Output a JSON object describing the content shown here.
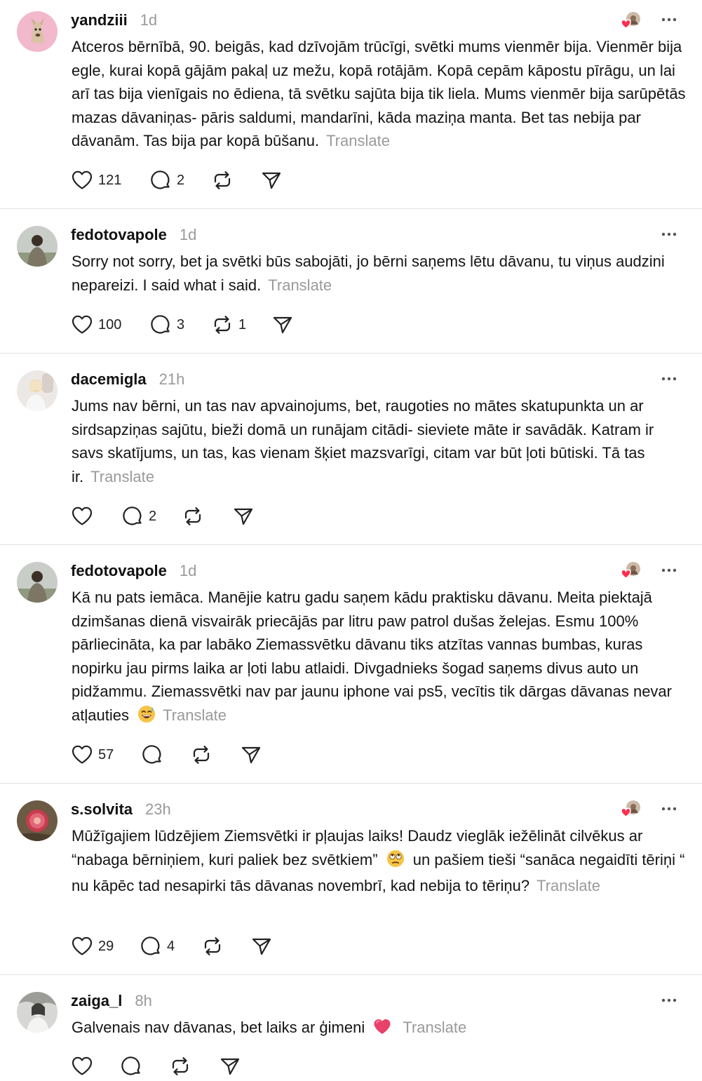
{
  "translate_label": "Translate",
  "posts": [
    {
      "username": "yandziii",
      "time": "1d",
      "text": "Atceros bērnībā, 90. beigās, kad dzīvojām trūcīgi, svētki mums vienmēr bija. Vienmēr bija egle, kurai kopā gājām pakaļ uz mežu, kopā rotājām. Kopā cepām kāpostu pīrāgu, un lai arī tas bija vienīgais no ēdiena, tā svētku sajūta bija tik liela. Mums vienmēr bija sarūpētās mazas dāvaniņas- pāris saldumi, mandarīni, kāda maziņa manta. Bet tas nebija par dāvanām. Tas bija par kopā būšanu.",
      "likes": "121",
      "replies": "2",
      "reposts": "",
      "liked_by_author": true
    },
    {
      "username": "fedotovapole",
      "time": "1d",
      "text": "Sorry not sorry, bet ja svētki būs sabojāti, jo bērni saņems lētu dāvanu, tu viņus audzini nepareizi. I said what i said.",
      "likes": "100",
      "replies": "3",
      "reposts": "1",
      "liked_by_author": false
    },
    {
      "username": "dacemigla",
      "time": "21h",
      "text": "Jums nav bērni, un tas nav apvainojums, bet, raugoties no mātes skatupunkta un ar sirdsapziņas sajūtu, bieži domā un runājam citādi- sieviete māte ir savādāk. Katram ir savs skatījums, un tas, kas vienam šķiet mazsvarīgi, citam var būt ļoti būtiski. Tā tas ir.",
      "likes": "",
      "replies": "2",
      "reposts": "",
      "liked_by_author": false
    },
    {
      "username": "fedotovapole",
      "time": "1d",
      "text": "Kā nu pats iemāca. Manējie katru gadu saņem kādu praktisku dāvanu. Meita piektajā dzimšanas dienā visvairāk priecājās par litru paw patrol dušas želejas. Esmu 100% pārliecināta, ka par labāko Ziemassvētku dāvanu tiks atzītas vannas bumbas, kuras nopirku jau pirms laika ar ļoti labu atlaidi. Divgadnieks šogad saņems divus auto un pidžammu. Ziemassvētki nav par jaunu iphone vai ps5, vecītis tik dārgas dāvanas nevar atļauties",
      "emoji": "sweat-smile-emoji",
      "likes": "57",
      "replies": "",
      "reposts": "",
      "liked_by_author": true
    },
    {
      "username": "s.solvita",
      "time": "23h",
      "text_parts": [
        "Mūžīgajiem lūdzējiem Ziemsvētki ir pļaujas laiks! Daudz vieglāk iežēlināt cilvēkus ar “nabaga bērniņiem, kuri paliek bez svētkiem”",
        "un pašiem tieši “sanāca negaidīti tēriņi “ nu kāpēc tad nesapirki tās dāvanas novembrī, kad nebija to tēriņu?"
      ],
      "emoji": "face-with-rolling-eyes-emoji",
      "likes": "29",
      "replies": "4",
      "reposts": "",
      "liked_by_author": true
    },
    {
      "username": "zaiga_l",
      "time": "8h",
      "text": "Galvenais nav dāvanas, bet laiks ar ģimeni",
      "emoji": "heart-emoji",
      "likes": "",
      "replies": "",
      "reposts": "",
      "liked_by_author": false
    }
  ],
  "colors": {
    "separator": "#e2e2e2",
    "muted": "#9a9a9a",
    "heart_red": "#ff2d4f",
    "text": "#141414"
  }
}
